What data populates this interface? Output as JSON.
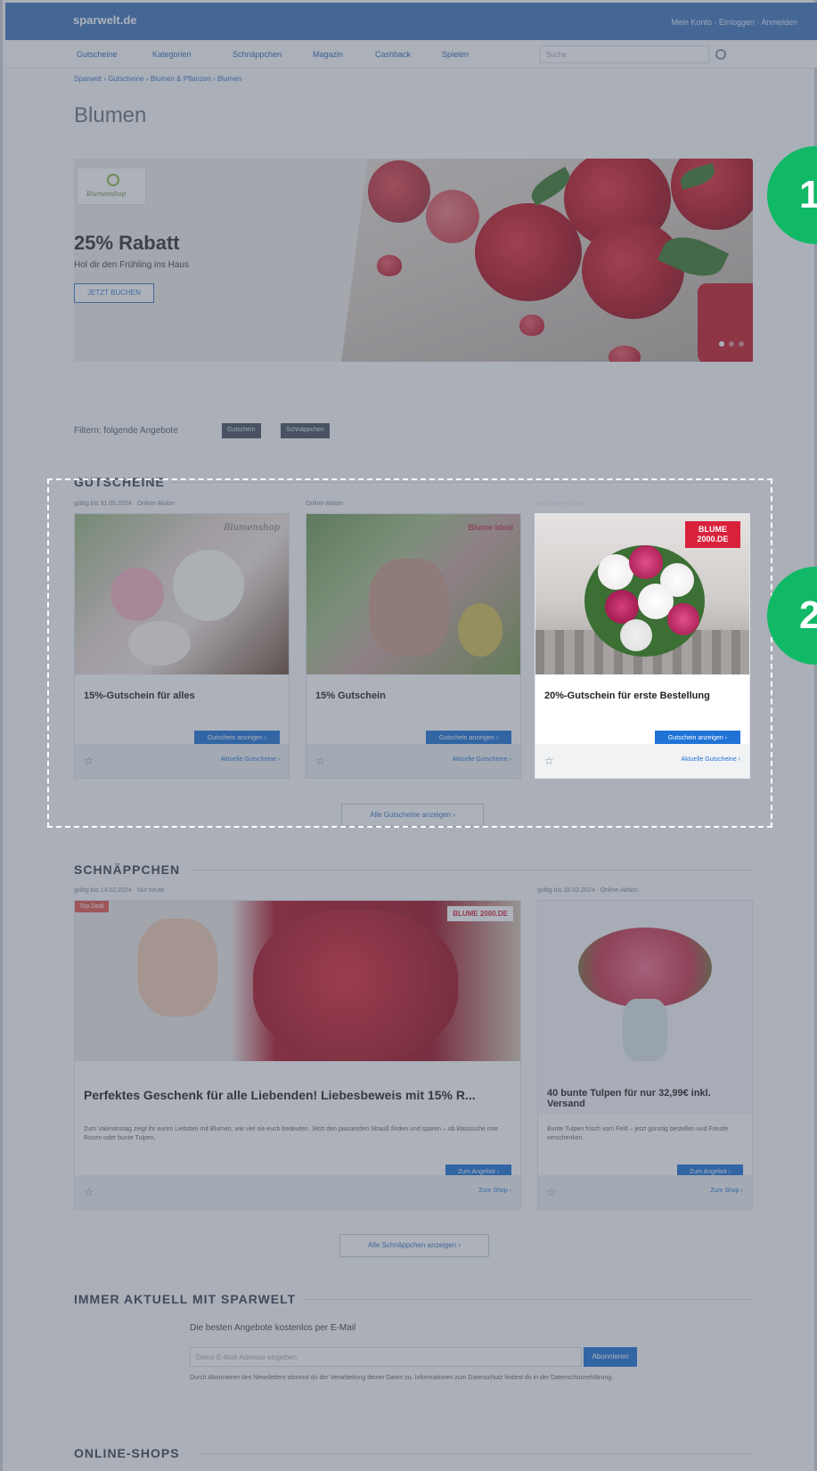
{
  "header": {
    "logo": "sparwelt.de",
    "top_links": "Mein Konto · Einloggen · Anmelden",
    "nav": [
      "Gutscheine",
      "Kategorien",
      "Schnäppchen",
      "Magazin",
      "Cashback",
      "Spielen"
    ],
    "search_placeholder": "Suche"
  },
  "breadcrumb": "Sparwelt › Gutscheine › Blumen & Pflanzen › Blumen",
  "page_title": "Blumen",
  "hero": {
    "title": "25% Rabatt",
    "subtitle": "Hol dir den Frühling ins Haus",
    "button": "JETZT BUCHEN",
    "logo_text": "Blumenshop"
  },
  "badges": [
    "1",
    "2"
  ],
  "filter": {
    "label": "Filtern: folgende Angebote",
    "chips": [
      "Gutschein",
      "Schnäppchen"
    ]
  },
  "gutscheine": {
    "title": "GUTSCHEINE",
    "cards": [
      {
        "meta": "gültig bis 31.05.2024 · Online-Aktion",
        "title": "15%-Gutschein für alles",
        "button": "Gutschein anzeigen ›",
        "link": "Aktuelle Gutscheine ›",
        "logo": "Blumenshop"
      },
      {
        "meta": "Online-Aktion",
        "title": "15% Gutschein",
        "button": "Gutschein anzeigen ›",
        "link": "Aktuelle Gutscheine ›",
        "logo": "Blume Ideal"
      },
      {
        "meta": "Neukunden-Aktion",
        "title": "20%-Gutschein für erste Bestellung",
        "button": "Gutschein anzeigen ›",
        "link": "Aktuelle Gutscheine ›",
        "logo": "BLUME 2000.DE"
      }
    ],
    "more_button": "Alle Gutscheine anzeigen ›"
  },
  "schnaeppchen": {
    "title": "SCHNÄPPCHEN",
    "deals": [
      {
        "meta": "gültig bis 14.02.2024 · Nur heute",
        "tag": "Top Deal",
        "title": "Perfektes Geschenk für alle Liebenden! Liebesbeweis mit 15% R...",
        "text": "Zum Valentinstag zeigt ihr euren Liebsten mit Blumen, wie viel sie euch bedeuten. Jetzt den passenden Strauß finden und sparen – ob klassische rote Rosen oder bunte Tulpen.",
        "button": "Zum Angebot ›",
        "link": "Zum Shop ›",
        "logo": "BLUME 2000.DE"
      },
      {
        "meta": "gültig bis 28.02.2024 · Online-Aktion",
        "title": "40 bunte Tulpen für nur 32,99€ inkl. Versand",
        "text": "Bunte Tulpen frisch vom Feld – jetzt günstig bestellen und Freude verschenken.",
        "button": "Zum Angebot ›",
        "link": "Zum Shop ›"
      }
    ],
    "more_button": "Alle Schnäppchen anzeigen ›"
  },
  "newsletter": {
    "section_title": "IMMER AKTUELL MIT SPARWELT",
    "label": "Die besten Angebote kostenlos per E-Mail",
    "placeholder": "Deine E-Mail-Adresse eingeben",
    "button": "Abonnieren",
    "note": "Durch Abonnieren des Newsletters stimmst du der Verarbeitung deiner Daten zu. Informationen zum Datenschutz findest du in der Datenschutzerklärung."
  },
  "online_shops_title": "ONLINE-SHOPS",
  "colors": {
    "brand": "#3f77bd",
    "button": "#1f73d6",
    "badge": "#11b966",
    "overlay": "#4a5468"
  }
}
